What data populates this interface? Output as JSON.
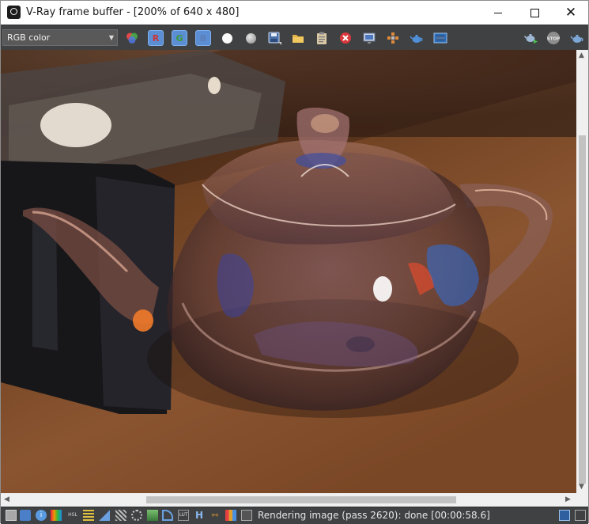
{
  "window": {
    "title": "V-Ray frame buffer - [200% of 640 x 480]"
  },
  "toolbar": {
    "channel_select": "RGB color",
    "red_channel": "R",
    "green_channel": "G",
    "blue_channel": "B"
  },
  "statusbar": {
    "message": "Rendering image (pass 2620): done [00:00:58.6]",
    "history_letter": "H"
  },
  "colors": {
    "toolbar_bg": "#404142",
    "channel_button": "#5b8ed3",
    "close_icon_red": "#d9383c"
  }
}
